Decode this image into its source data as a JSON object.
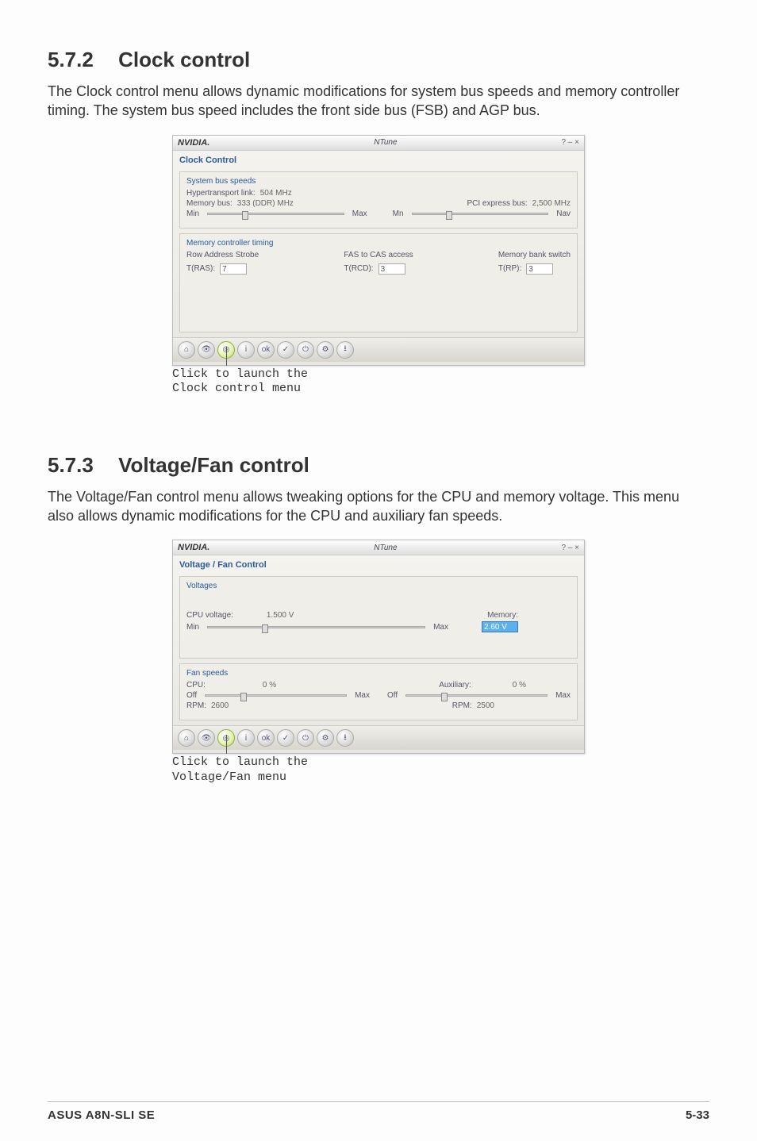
{
  "sections": {
    "clock": {
      "number": "5.7.2",
      "title": "Clock control",
      "paragraph": "The Clock control menu allows dynamic modifications for system bus speeds and memory controller timing. The system bus speed includes the front side bus (FSB) and AGP bus.",
      "caption": "Click to launch the\nClock control menu",
      "window": {
        "brand": "NVIDIA.",
        "appname": "NTune",
        "winctrls": "?  –  ×",
        "pageLabel": "Clock Control",
        "panel1": {
          "legend": "System bus speeds",
          "ht_label": "Hypertransport link:",
          "ht_val": "504 MHz",
          "mem_label": "Memory bus:",
          "mem_val": "333 (DDR) MHz",
          "pci_label": "PCI express bus:",
          "pci_val": "2,500 MHz",
          "slider_min": "Min",
          "slider_max": "Max",
          "slider_mn": "Mn",
          "slider_nav": "Nav"
        },
        "panel2": {
          "legend": "Memory controller timing",
          "ras_label": "Row Address Strobe",
          "ras_field": "T(RAS):",
          "ras_val": "7",
          "fas_label": "FAS to CAS access",
          "rcd_field": "T(RCD):",
          "rcd_val": "3",
          "bank_label": "Memory bank switch",
          "rp_field": "T(RP):",
          "rp_val": "3"
        }
      }
    },
    "voltage": {
      "number": "5.7.3",
      "title": "Voltage/Fan control",
      "paragraph": "The Voltage/Fan control menu allows tweaking options for the CPU and memory voltage. This menu also allows dynamic modifications for the CPU and auxiliary fan speeds.",
      "caption": "Click to launch the\nVoltage/Fan menu",
      "window": {
        "brand": "NVIDIA.",
        "appname": "NTune",
        "winctrls": "?  –  ×",
        "pageLabel": "Voltage / Fan Control",
        "panel1": {
          "legend": "Voltages",
          "cpu_label": "CPU voltage:",
          "cpu_val": "1.500 V",
          "min": "Min",
          "max": "Max",
          "mem_label": "Memory:",
          "mem_val": "2.60 V"
        },
        "panel2": {
          "legend": "Fan speeds",
          "cpu_label": "CPU:",
          "cpu_pct": "0 %",
          "aux_label": "Auxiliary:",
          "aux_pct": "0 %",
          "off": "Off",
          "max": "Max",
          "rpm_cpu_label": "RPM:",
          "rpm_cpu_val": "2600",
          "rpm_aux_label": "RPM:",
          "rpm_aux_val": "2500"
        }
      }
    }
  },
  "toolbar": {
    "buttons": [
      "home",
      "eye",
      "target",
      "info",
      "ok",
      "check",
      "power",
      "gear",
      "disk"
    ]
  },
  "footer": {
    "product": "ASUS A8N-SLI SE",
    "page": "5-33"
  }
}
